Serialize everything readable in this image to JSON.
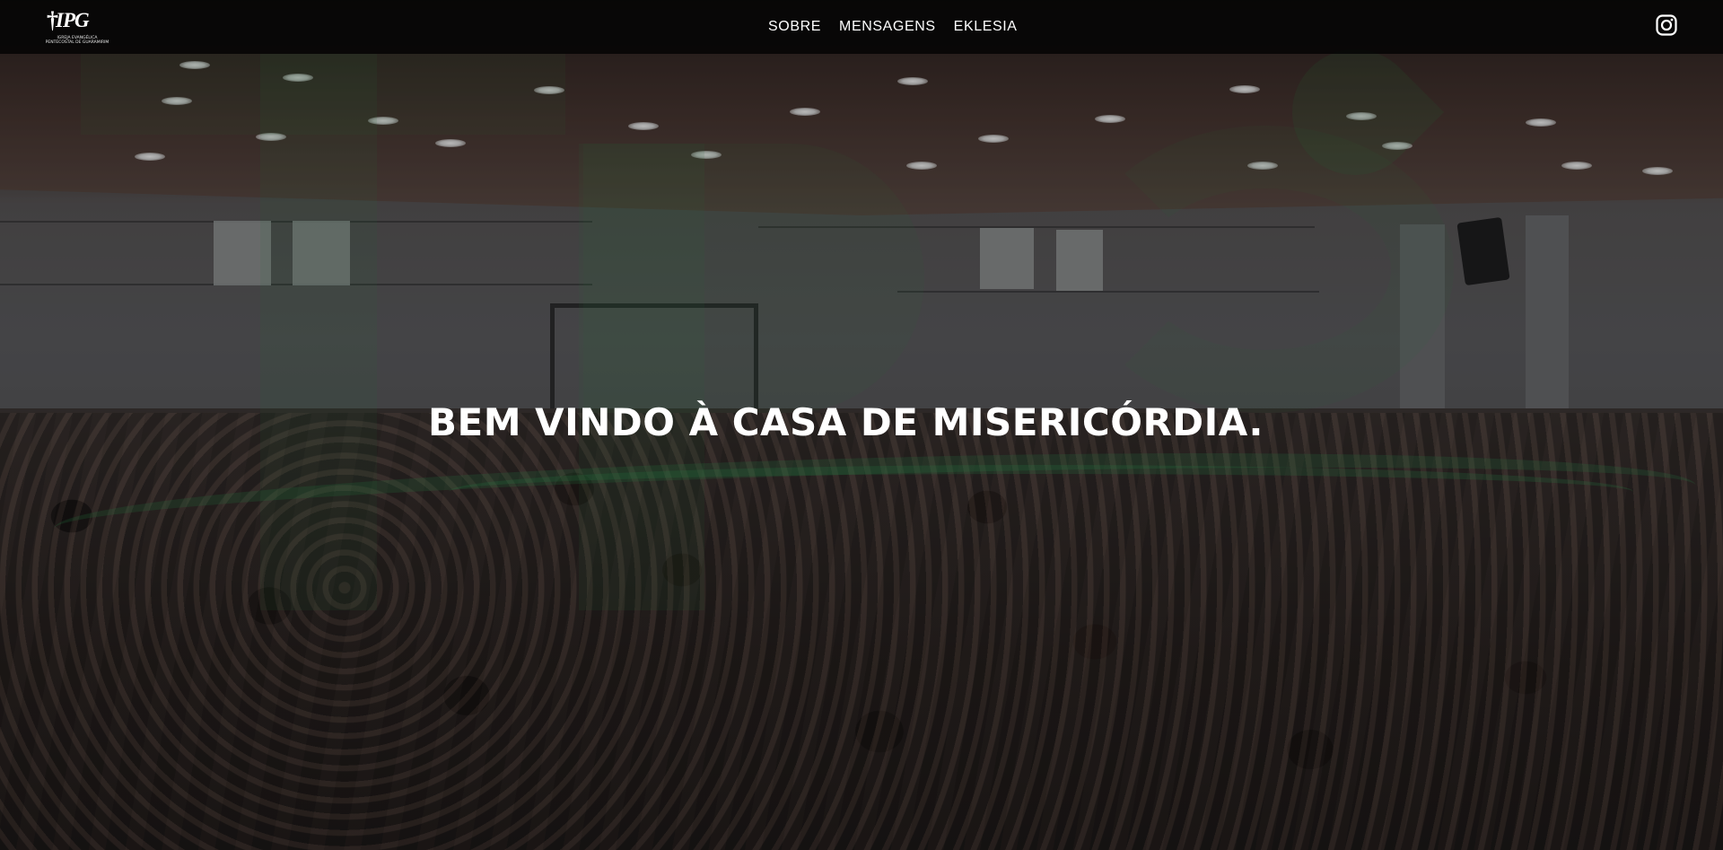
{
  "brand": {
    "logo_text": "IPG",
    "logo_tagline": "IGREJA EVANGÉLICA PENTECOSTAL DE GUARAMIRIM",
    "accent_color": "#2f9a55"
  },
  "nav": {
    "items": [
      {
        "label": "SOBRE"
      },
      {
        "label": "MENSAGENS"
      },
      {
        "label": "EKLESIA"
      }
    ]
  },
  "social": {
    "instagram_icon": "instagram-icon"
  },
  "hero": {
    "headline": "BEM VINDO À CASA DE MISERICÓRDIA."
  }
}
